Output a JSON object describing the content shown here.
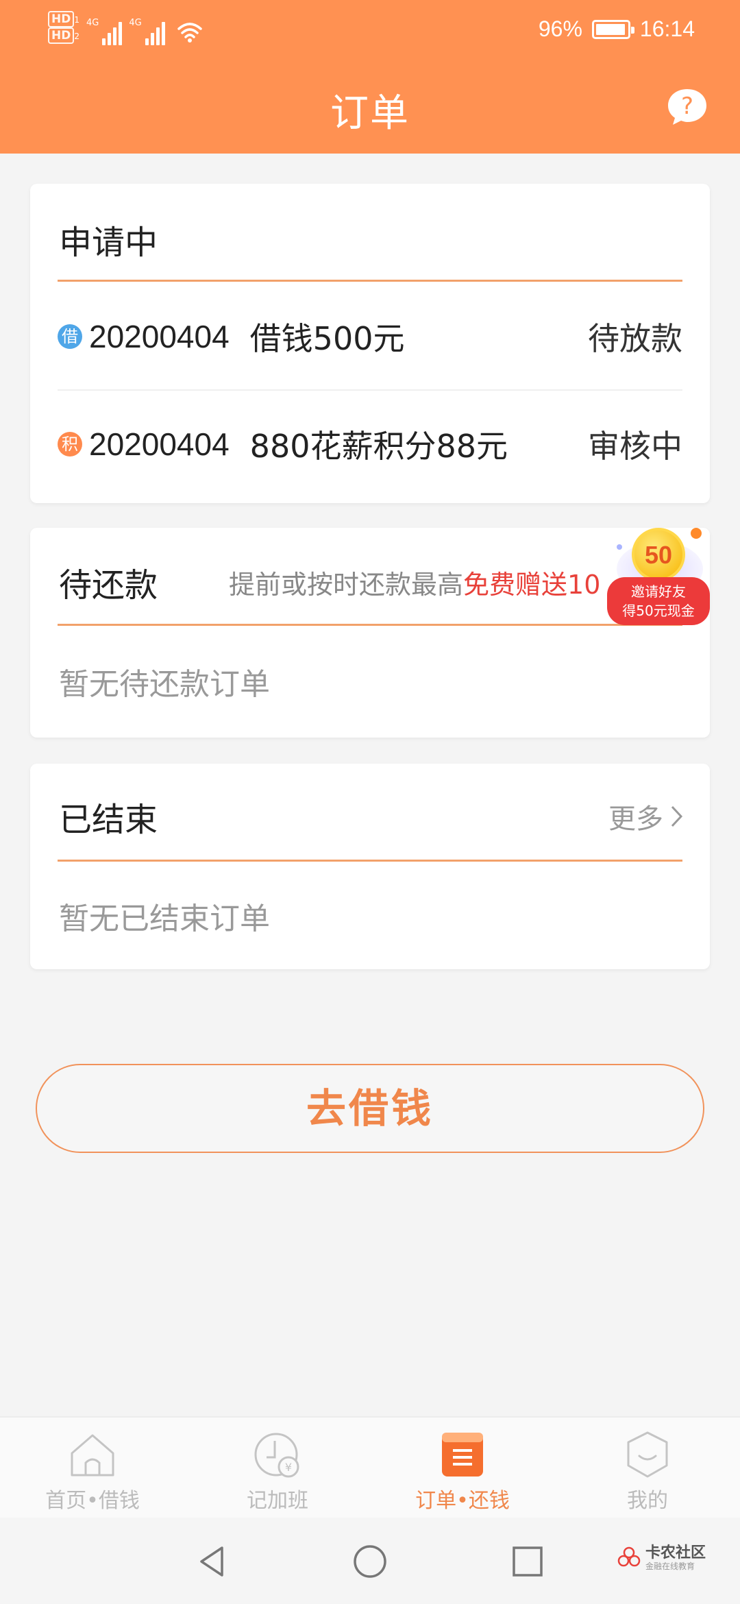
{
  "status_bar": {
    "hd1": "HD",
    "hd1_sub": "1",
    "hd2": "HD",
    "hd2_sub": "2",
    "net1": "4G",
    "net2": "4G",
    "battery_pct_text": "96%",
    "battery_level": 0.96,
    "time": "16:14"
  },
  "header": {
    "title": "订单"
  },
  "applying": {
    "title": "申请中",
    "orders": [
      {
        "tag": "借",
        "tag_color": "#4fa6e8",
        "id": "20200404",
        "desc": "借钱500元",
        "status": "待放款"
      },
      {
        "tag": "积",
        "tag_color": "#ff8a4d",
        "id": "20200404",
        "desc": "880花薪积分88元",
        "status": "审核中"
      }
    ]
  },
  "repay": {
    "title": "待还款",
    "promo_prefix": "提前或按时还款最高",
    "promo_highlight": "免费赠送10",
    "empty": "暂无待还款订单"
  },
  "invite_badge": {
    "coin": "50",
    "line1": "邀请好友",
    "line2": "得50元现金"
  },
  "finished": {
    "title": "已结束",
    "more": "更多",
    "empty": "暂无已结束订单"
  },
  "borrow_button": "去借钱",
  "tabs": [
    {
      "label": "首页•借钱",
      "icon": "home-icon",
      "active": false
    },
    {
      "label": "记加班",
      "icon": "clock-yen-icon",
      "active": false
    },
    {
      "label": "订单•还钱",
      "icon": "order-list-icon",
      "active": true
    },
    {
      "label": "我的",
      "icon": "smile-face-icon",
      "active": false
    }
  ],
  "watermark": {
    "main": "卡农社区",
    "sub": "金融在线教育"
  },
  "colors": {
    "accent": "#ff9152",
    "highlight": "#e8413a",
    "tab_active": "#f0874b"
  }
}
